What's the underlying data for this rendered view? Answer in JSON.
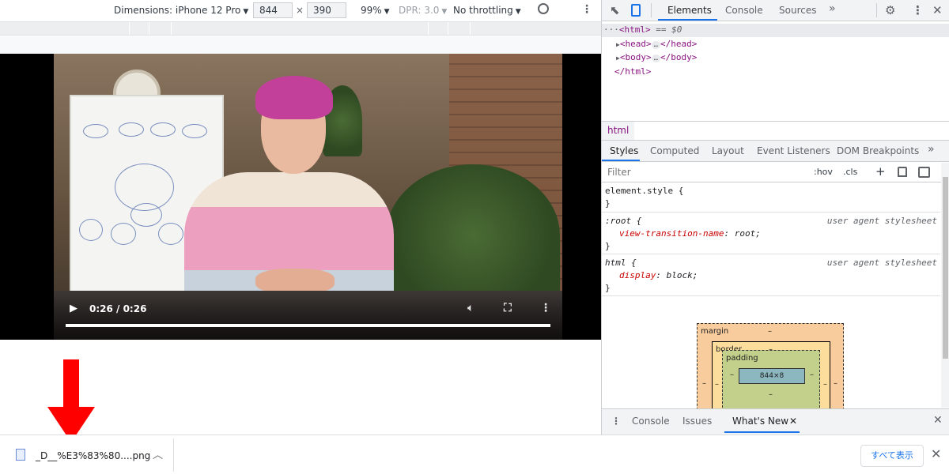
{
  "device_toolbar": {
    "dimensions_label": "Dimensions: iPhone 12 Pro",
    "width_value": "844",
    "times": "×",
    "height_value": "390",
    "zoom": "99%",
    "dpr": "DPR: 3.0",
    "throttling": "No throttling"
  },
  "video": {
    "time": "0:26 / 0:26",
    "progress": 1.0
  },
  "devtools": {
    "tabs": [
      "Elements",
      "Console",
      "Sources"
    ],
    "more": "»",
    "tree": {
      "html_open": "<html>",
      "selected_marker": "== $0",
      "head_open": "<head>",
      "head_close": "</head>",
      "body_open": "<body>",
      "body_close": "</body>",
      "html_close": "</html>",
      "ellipsis": "…",
      "row_dots": "···"
    },
    "breadcrumb": "html",
    "style_tabs": [
      "Styles",
      "Computed",
      "Layout",
      "Event Listeners",
      "DOM Breakpoints"
    ],
    "filter_placeholder": "Filter",
    "hov": ":hov",
    "cls": ".cls",
    "plus": "+",
    "rules": {
      "element_style": "element.style {",
      "close": "}",
      "root_selector": ":root {",
      "root_prop": "view-transition-name",
      "root_val": "root;",
      "html_selector": "html {",
      "html_prop": "display",
      "html_val": "block;",
      "ua": "user agent stylesheet"
    },
    "box_model": {
      "margin": "margin",
      "border": "border",
      "padding": "padding",
      "dash": "–",
      "content": "844×8"
    },
    "drawer_tabs": [
      "Console",
      "Issues",
      "What's New"
    ]
  },
  "download_bar": {
    "filename": "_D__%E3%83%80....png",
    "show_all": "すべて表示"
  },
  "colors": {
    "accent": "#1a73e8",
    "tag": "#881280",
    "prop": "#c80000",
    "arrow": "#ff0000"
  }
}
